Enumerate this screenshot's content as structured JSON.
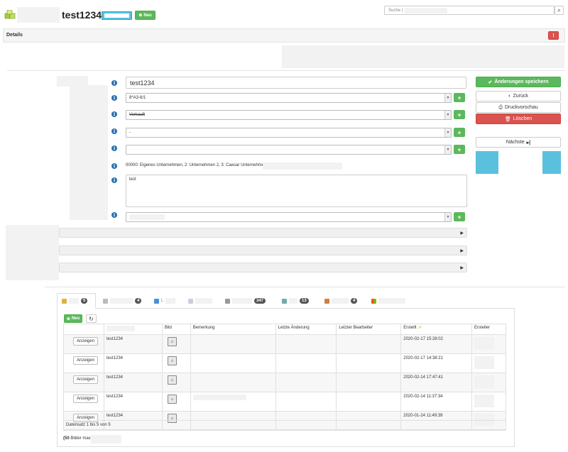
{
  "header": {
    "title": "test1234",
    "new_button": "Neu",
    "search_placeholder": "Suche (",
    "search_icon": "magnifier-icon",
    "logo_icon": "cubes-icon"
  },
  "details": {
    "label": "Details",
    "alert_icon": "!"
  },
  "form": {
    "name_value": "test1234",
    "field2_value": "8*A3-6/1",
    "field3_value": "Verkauft",
    "field4_value": "-",
    "field5_value": "",
    "company_text": "00000: Eigenes Unternehmen, 2: Unternehmen 2, 3: Caesar Unternehmen",
    "comment_value": "test",
    "plus": "+"
  },
  "actions": {
    "save": "Änderungen speichern",
    "back": "Zurück",
    "print": "Druckvorschau",
    "delete": "Löschen",
    "next": "Nächste"
  },
  "tabs": [
    {
      "label": "",
      "badge": "5"
    },
    {
      "label": "",
      "badge": "4"
    },
    {
      "label": "L",
      "badge": ""
    },
    {
      "label": "",
      "badge": ""
    },
    {
      "label": "",
      "badge": "347"
    },
    {
      "label": "",
      "badge": "13"
    },
    {
      "label": "",
      "badge": "4"
    },
    {
      "label": "",
      "badge": ""
    }
  ],
  "table": {
    "new_button": "Neu",
    "refresh_icon": "refresh-icon",
    "headers": [
      "",
      "",
      "Bild",
      "Bemerkung",
      "Letzte Änderung",
      "Letzter Bearbeiter",
      "Erstellt",
      "Ersteller"
    ],
    "sort_indicator": "↓F",
    "show_label": "Anzeigen",
    "rows": [
      {
        "name": "test1234",
        "created": "2020-02-17 15:28:02"
      },
      {
        "name": "test1234",
        "created": "2020-02-17 14:38:21"
      },
      {
        "name": "test1234",
        "created": "2020-02-14 17:47:41"
      },
      {
        "name": "test1234",
        "created": "2020-02-14 11:37:34"
      },
      {
        "name": "test1234",
        "created": "2020-01-24 11:49:39"
      }
    ],
    "footer": "Datensatz 1 bis 5 von 5"
  },
  "bottom_note_bold": "(50",
  "bottom_note": " Bilder max."
}
